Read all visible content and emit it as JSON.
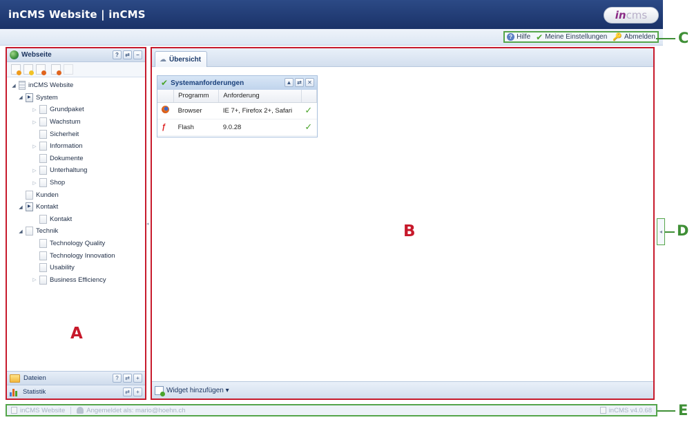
{
  "header": {
    "title": "inCMS Website | inCMS",
    "logo_in": "in",
    "logo_cms": "cms"
  },
  "toplinks": {
    "help": "Hilfe",
    "settings": "Meine Einstellungen",
    "logout": "Abmelden"
  },
  "callouts": {
    "a": "A",
    "b": "B",
    "c": "C",
    "d": "D",
    "e": "E"
  },
  "left_panel": {
    "title": "Webseite",
    "tool_buttons": [
      "?",
      "⇄",
      "–"
    ],
    "tree": [
      {
        "label": "inCMS Website",
        "level": 0,
        "arrow": "open",
        "icon": "site"
      },
      {
        "label": "System",
        "level": 1,
        "arrow": "open",
        "icon": "folder"
      },
      {
        "label": "Grundpaket",
        "level": 2,
        "arrow": "closed",
        "icon": "page"
      },
      {
        "label": "Wachstum",
        "level": 2,
        "arrow": "closed",
        "icon": "page"
      },
      {
        "label": "Sicherheit",
        "level": 2,
        "arrow": "none",
        "icon": "page"
      },
      {
        "label": "Information",
        "level": 2,
        "arrow": "closed",
        "icon": "page"
      },
      {
        "label": "Dokumente",
        "level": 2,
        "arrow": "none",
        "icon": "page"
      },
      {
        "label": "Unterhaltung",
        "level": 2,
        "arrow": "closed",
        "icon": "page"
      },
      {
        "label": "Shop",
        "level": 2,
        "arrow": "closed",
        "icon": "page"
      },
      {
        "label": "Kunden",
        "level": 1,
        "arrow": "none",
        "icon": "page"
      },
      {
        "label": "Kontakt",
        "level": 1,
        "arrow": "open",
        "icon": "folder"
      },
      {
        "label": "Kontakt",
        "level": 2,
        "arrow": "none",
        "icon": "page"
      },
      {
        "label": "Technik",
        "level": 1,
        "arrow": "open",
        "icon": "page"
      },
      {
        "label": "Technology Quality",
        "level": 2,
        "arrow": "none",
        "icon": "page"
      },
      {
        "label": "Technology Innovation",
        "level": 2,
        "arrow": "none",
        "icon": "page"
      },
      {
        "label": "Usability",
        "level": 2,
        "arrow": "none",
        "icon": "page"
      },
      {
        "label": "Business Efficiency",
        "level": 2,
        "arrow": "closed",
        "icon": "page"
      }
    ],
    "footer_files": "Dateien",
    "footer_files_buttons": [
      "?",
      "⇄",
      "+"
    ],
    "footer_stats": "Statistik",
    "footer_stats_buttons": [
      "⇄",
      "+"
    ]
  },
  "main_panel": {
    "tab": "Übersicht",
    "widget": {
      "title": "Systemanforderungen",
      "buttons": [
        "▲",
        "⇄",
        "✕"
      ],
      "columns": [
        "Programm",
        "Anforderung"
      ],
      "rows": [
        {
          "program": "Browser",
          "requirement": "IE 7+, Firefox 2+, Safari",
          "status": "✓"
        },
        {
          "program": "Flash",
          "requirement": "9.0.28",
          "status": "✓"
        }
      ]
    },
    "footer_add_widget": "Widget hinzufügen ▾"
  },
  "statusbar": {
    "site": "inCMS Website",
    "logged_in": "Angemeldet als: mario@hoehn.ch",
    "version": "inCMS v4.0.68"
  },
  "colors": {
    "header_bg": "#1f3a74",
    "region_outline": "#c7192b",
    "callout_green": "#3f8f36"
  }
}
